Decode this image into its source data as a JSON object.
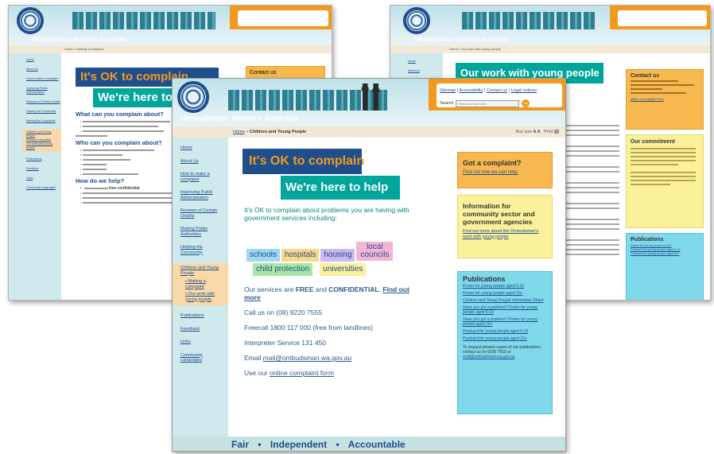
{
  "site": {
    "name": "Ombudsman Western Australia",
    "header_links": [
      "Sitemap",
      "Accessibility",
      "Contact us",
      "Legal notices"
    ],
    "search_label": "Search",
    "search_placeholder": "Enter your text here",
    "search_go": "Go",
    "text_size_label": "Text size",
    "text_size_glyphs": "A A",
    "print_label": "Print"
  },
  "front": {
    "breadcrumb_home": "Home",
    "breadcrumb_sep": "»",
    "breadcrumb_current": "Children and Young People",
    "sidebar": [
      "Home",
      "About Us",
      "How to make a complaint",
      "Improving Public Administration",
      "Reviews of Certain Deaths",
      "Making Public Authorities",
      "Helping the Community",
      "Children and Young People",
      "Publications",
      "Feedback",
      "Links",
      "Community Languages"
    ],
    "sidebar_sub": [
      "Making a complaint",
      "Our work with young people"
    ],
    "ok_heading": "It's OK to complain",
    "help_heading": "We're here to help",
    "intro": "It's OK to complain about problems you are having with government services including:",
    "words": [
      "schools",
      "hospitals",
      "housing",
      "local councils",
      "child protection",
      "universities"
    ],
    "services_prefix": "Our services are ",
    "services_free": "FREE",
    "services_and": " and ",
    "services_conf": "CONFIDENTIAL",
    "services_suffix": ". ",
    "services_link": "Find out more",
    "call": "Call us on (08) 9220 7555",
    "freecall": "Freecall 1800 117 000 (free from landlines)",
    "interpreter": "Interpreter Service 131 450",
    "email_prefix": "Email ",
    "email": "mail@ombudsman.wa.gov.au",
    "online_prefix": "Use our ",
    "online_link": "online complaint form",
    "got_title": "Got a complaint?",
    "got_link": "Find out how we can help.",
    "info_title": "Information for community sector and government agencies",
    "info_link": "Find out more about the Ombudsman's work with young people",
    "pubs_title": "Publications",
    "pubs": [
      "Poster for young people aged 5-10",
      "Poster for young people aged 10+",
      "Children and Young People Information Sheet",
      "Have you got a problem? Poster for young people aged 5-10",
      "Have you got a problem? Poster for young people aged 10+",
      "Postcard for young people aged 5-10",
      "Postcard for young people aged 10+"
    ],
    "pubs_note": "To request printed copies of our publications, contact us on 9220 7555 or",
    "pubs_email": "mail@ombudsman.wa.gov.au",
    "footer": [
      "Fair",
      "Independent",
      "Accountable"
    ],
    "footer_dot": "•"
  },
  "left": {
    "ok_heading": "It's OK to complain",
    "help_heading": "We're here to help",
    "breadcrumb_current": "Making a complaint",
    "sidebar": [
      "Home",
      "About Us",
      "How to make a complaint",
      "Improving Public Administration",
      "Reviews of Certain Deaths",
      "Helping the Community",
      "Making the Complaints",
      "Children and Young People",
      "Publications",
      "Feedback",
      "Links",
      "Community Languages"
    ],
    "sidebar_sub": [
      "Making a complaint",
      "Our work with young people"
    ],
    "h1": "What can you complain about?",
    "h2": "Who can you complain about?",
    "h3": "How do we help?",
    "right_box": "Contact us",
    "help_free": "free",
    "help_conf": "confidential"
  },
  "right": {
    "heading": "Our work with young people",
    "breadcrumb_current": "Our work with young people",
    "sidebar": [
      "Home",
      "About Us"
    ],
    "contact_title": "Contact us",
    "contact_link": "Make a complaint Form",
    "commitment_title": "Our commitment",
    "publications_title": "Publications",
    "pubs": [
      "Poster for young people (5-10)",
      "Postcard for young people aged 5-10",
      "Postcard for young people aged 10+"
    ]
  }
}
